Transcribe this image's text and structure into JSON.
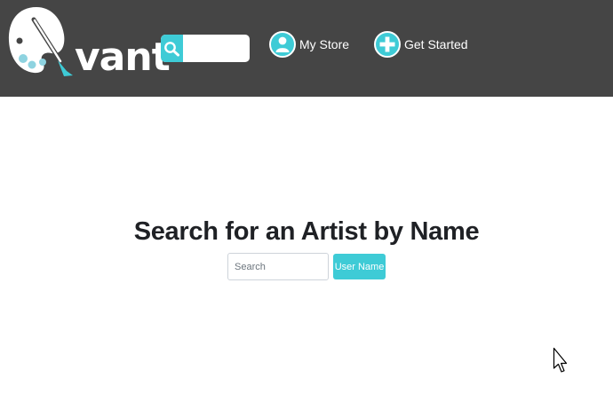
{
  "header": {
    "logo_text": "vant",
    "search_placeholder": "",
    "nav": [
      {
        "label": "My Store",
        "icon": "user-icon"
      },
      {
        "label": "Get Started",
        "icon": "plus-icon"
      }
    ]
  },
  "main": {
    "heading": "Search for an Artist by Name",
    "search_placeholder": "Search",
    "button_label": "User Name"
  },
  "colors": {
    "navbar": "#454545",
    "accent": "#3ecbd6",
    "heading": "#1f2125",
    "background": "#ffffff"
  }
}
